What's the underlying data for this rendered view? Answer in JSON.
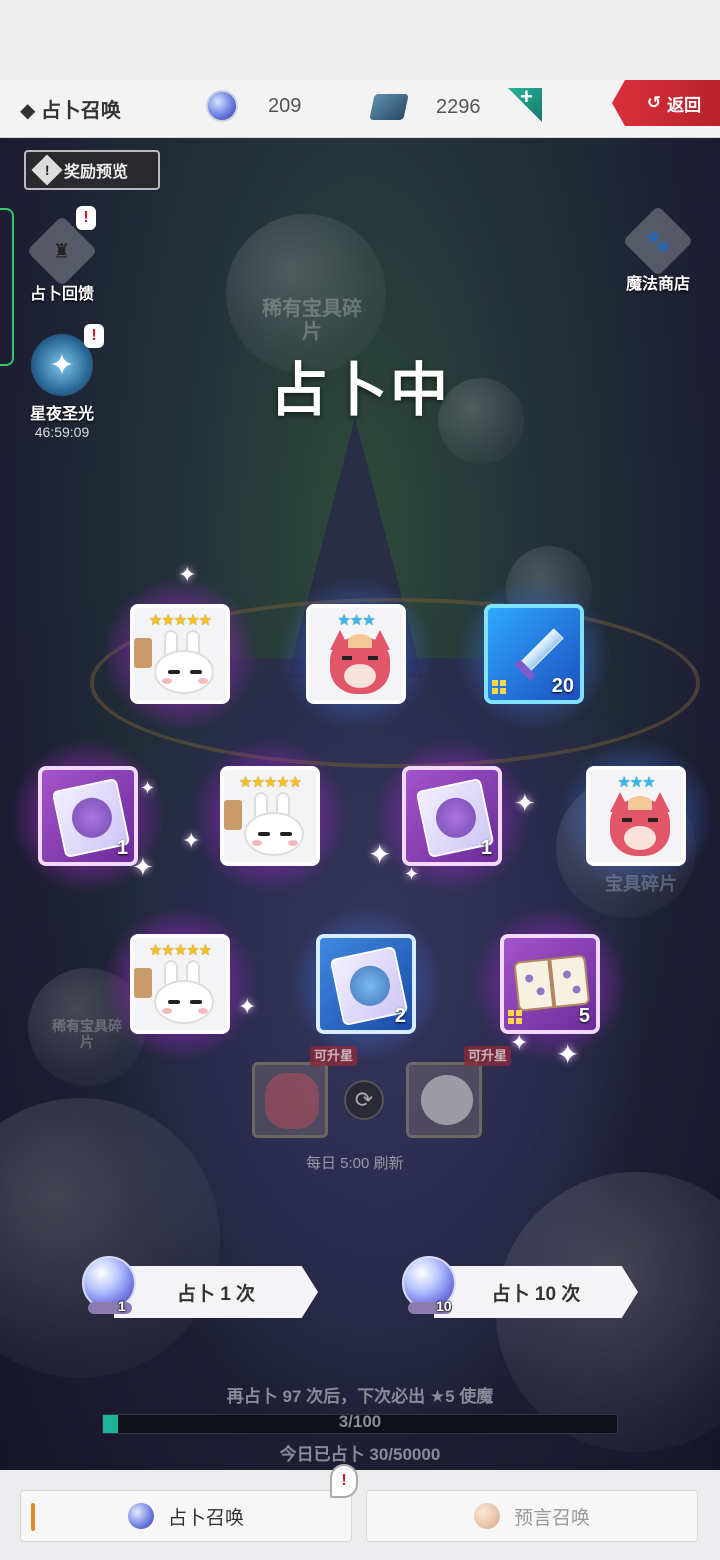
{
  "header": {
    "title": "◆ 占卜召唤",
    "orb_count": "209",
    "gem_count": "2296",
    "plus_label": "+",
    "back_label": "返回"
  },
  "side": {
    "reward_preview": "奖励预览",
    "divination_feedback": "占卜回馈",
    "starry_night": "星夜圣光",
    "starry_timer": "46:59:09",
    "magic_shop": "魔法商店",
    "alert": "!"
  },
  "background": {
    "rare_treasure_fragment": "稀有宝具碎片",
    "treasure_fragment": "宝具碎片",
    "rare_treasure_fragment_small": "稀有宝具碎片"
  },
  "status": "占卜中",
  "results": [
    {
      "kind": "bunny",
      "stars": "★★★★★",
      "star_color": "gold",
      "frame": "white",
      "qty": ""
    },
    {
      "kind": "fox",
      "stars": "★★★",
      "star_color": "blue",
      "frame": "white",
      "qty": ""
    },
    {
      "kind": "sword",
      "stars": "",
      "frame": "blue-bright",
      "qty": "20"
    },
    {
      "kind": "scroll-purple",
      "stars": "",
      "frame": "purple",
      "qty": "1"
    },
    {
      "kind": "bunny",
      "stars": "★★★★★",
      "star_color": "gold",
      "frame": "white",
      "qty": ""
    },
    {
      "kind": "scroll-purple",
      "stars": "",
      "frame": "purple",
      "qty": "1"
    },
    {
      "kind": "fox",
      "stars": "★★★",
      "star_color": "blue",
      "frame": "white",
      "qty": ""
    },
    {
      "kind": "bunny",
      "stars": "★★★★★",
      "star_color": "gold",
      "frame": "white",
      "qty": ""
    },
    {
      "kind": "scroll-blue",
      "stars": "",
      "frame": "blue",
      "qty": "2"
    },
    {
      "kind": "book",
      "stars": "",
      "frame": "purple",
      "qty": "5"
    }
  ],
  "upgrade": {
    "tag": "可升星",
    "refresh_text": "每日 5:00 刷新"
  },
  "draw": {
    "single_label": "占卜 1 次",
    "single_cost": "1",
    "ten_label": "占卜 10 次",
    "ten_cost": "10"
  },
  "pity": {
    "text": "再占卜 97 次后，下次必出 ★5 使魔",
    "progress_label": "3/100",
    "progress_value": 0.03,
    "daily_text": "今日已占卜 30/50000"
  },
  "tabs": {
    "divination_summon": "占卜召唤",
    "prophecy_summon": "预言召唤",
    "alert": "!"
  },
  "colors": {
    "accent_red": "#d9303b",
    "progress_fill": "#1fb29a",
    "gold_star": "#f6c21b",
    "blue_star": "#39b7f0"
  }
}
